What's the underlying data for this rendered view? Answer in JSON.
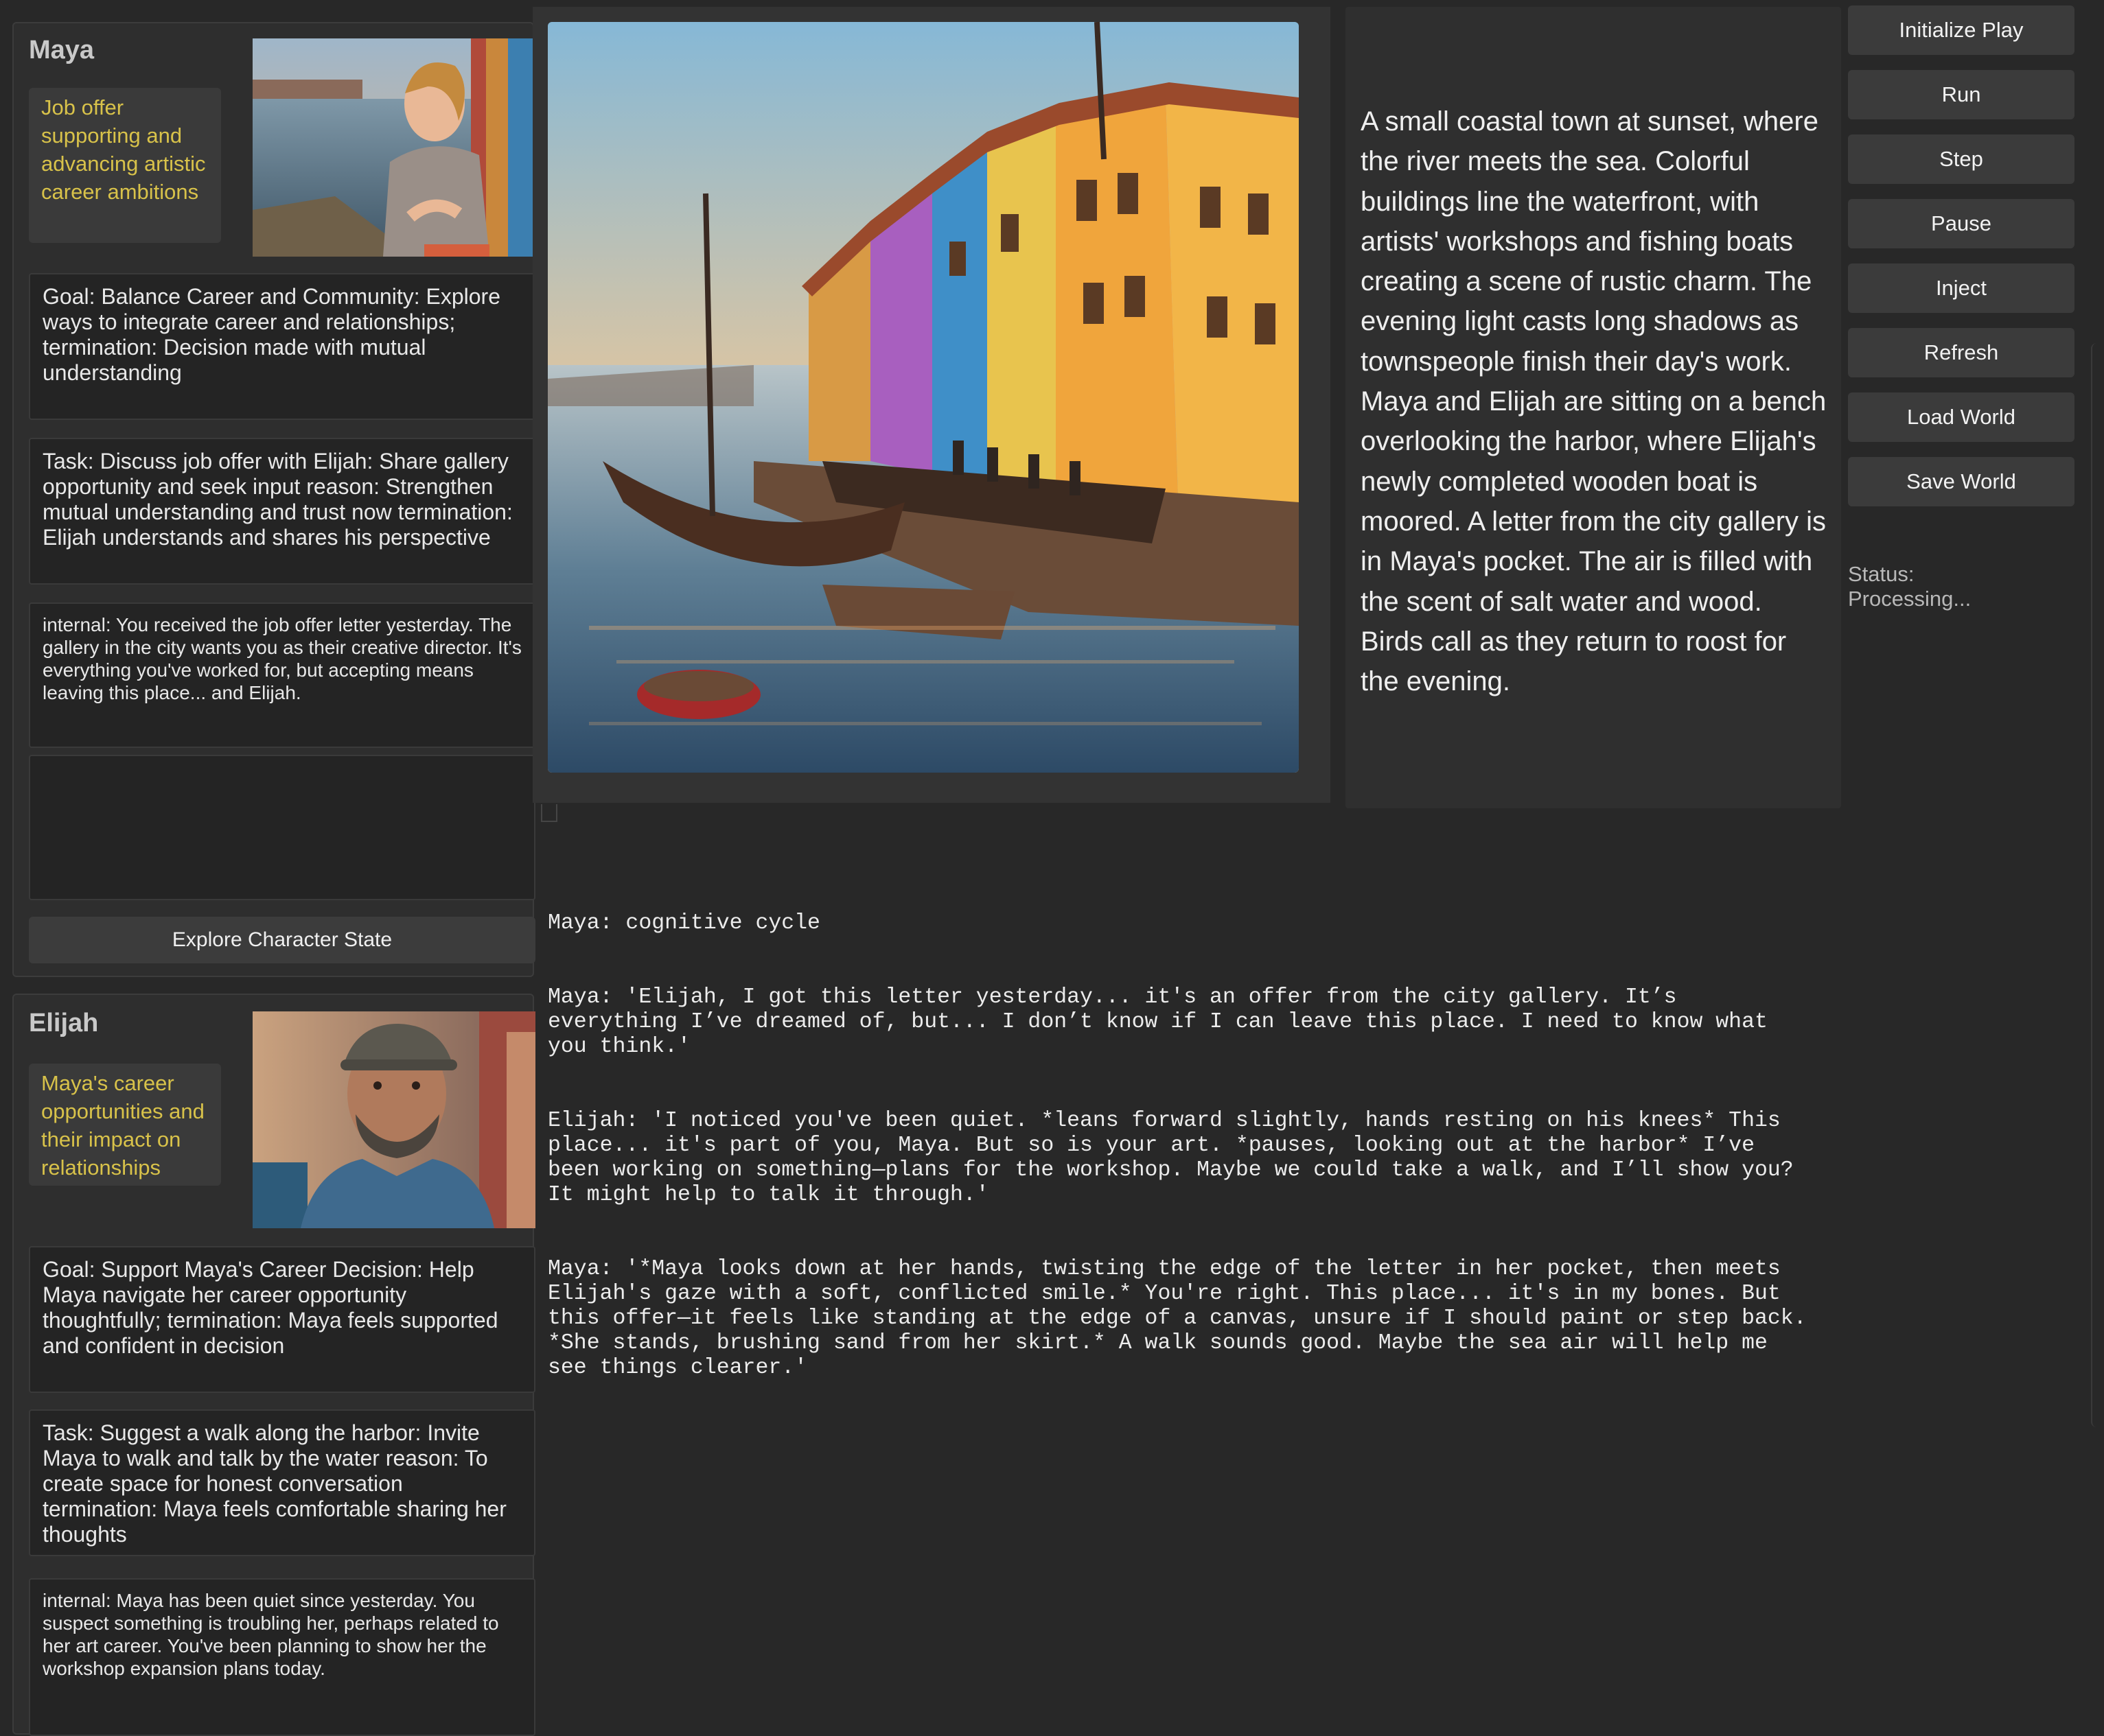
{
  "characters": [
    {
      "name": "Maya",
      "concern": "Job offer supporting and advancing artistic career ambitions",
      "goal": "Goal: Balance Career and Community: Explore ways to integrate career and relationships; termination: Decision made with mutual understanding",
      "task": "Task: Discuss job offer with Elijah: Share gallery opportunity and seek input reason: Strengthen mutual understanding and trust now termination: Elijah understands and shares his perspective",
      "internal": "internal: You received the job offer letter yesterday. The gallery in the city wants you as their creative director. It's everything you've worked for, but accepting means leaving this place... and Elijah.",
      "extra": "",
      "explore_label": "Explore Character State"
    },
    {
      "name": "Elijah",
      "concern": "Maya's career opportunities and their impact on relationships",
      "goal": "Goal: Support Maya's Career Decision: Help Maya navigate her career opportunity thoughtfully; termination: Maya feels supported and confident in decision",
      "task": "Task: Suggest a walk along the harbor: Invite Maya to walk and talk by the water reason: To create space for honest conversation termination: Maya feels comfortable sharing her thoughts",
      "internal": "internal: Maya has been quiet since yesterday. You suspect something is troubling her, perhaps related to her art career. You've been planning to show her the workshop expansion plans today."
    }
  ],
  "scene": {
    "description": "A small coastal town at sunset, where the river meets the sea. Colorful buildings line the waterfront, with artists' workshops and fishing boats creating a scene of rustic charm. The evening light casts long shadows as townspeople finish their day's work. Maya and Elijah are sitting on a bench overlooking the harbor, where Elijah's newly completed wooden boat is moored. A letter from the city gallery is in Maya's pocket. The air is filled with the scent of salt water and wood. Birds call as they return to roost for the evening."
  },
  "controls": {
    "initialize_play": "Initialize Play",
    "run": "Run",
    "step": "Step",
    "pause": "Pause",
    "inject": "Inject",
    "refresh": "Refresh",
    "load_world": "Load World",
    "save_world": "Save World"
  },
  "status": {
    "label": "Status:",
    "value": "Processing..."
  },
  "log": [
    "Maya: cognitive cycle",
    "Maya: 'Elijah, I got this letter yesterday... it's an offer from the city gallery. It’s everything I’ve dreamed of, but... I don’t know if I can leave this place. I need to know what you think.'",
    "Elijah: 'I noticed you've been quiet. *leans forward slightly, hands resting on his knees* This place... it's part of you, Maya. But so is your art. *pauses, looking out at the harbor* I’ve been working on something—plans for the workshop. Maybe we could take a walk, and I’ll show you? It might help to talk it through.'",
    "Maya: '*Maya looks down at her hands, twisting the edge of the letter in her pocket, then meets Elijah's gaze with a soft, conflicted smile.* You're right. This place... it's in my bones. But this offer—it feels like standing at the edge of a canvas, unsure if I should paint or step back. *She stands, brushing sand from her skirt.* A walk sounds good. Maybe the sea air will help me see things clearer.'"
  ]
}
